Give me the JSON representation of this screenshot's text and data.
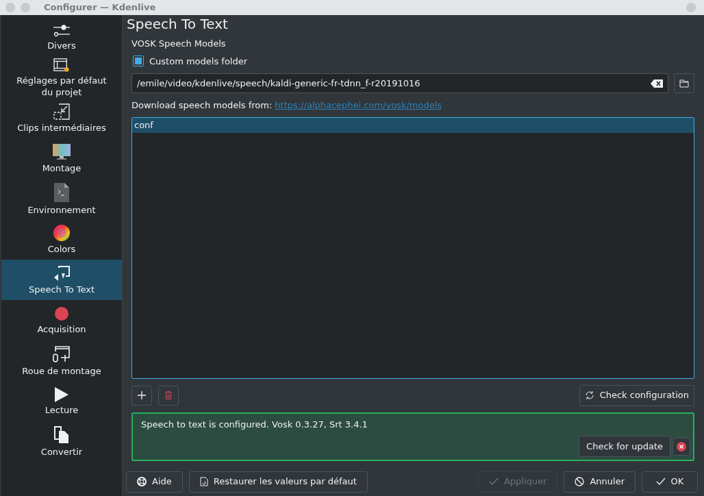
{
  "window": {
    "title": "Configurer — Kdenlive"
  },
  "sidebar": {
    "items": [
      {
        "label": "Divers",
        "selected": false
      },
      {
        "label": "Réglages par défaut du projet",
        "selected": false
      },
      {
        "label": "Clips intermédiaires",
        "selected": false
      },
      {
        "label": "Montage",
        "selected": false
      },
      {
        "label": "Environnement",
        "selected": false
      },
      {
        "label": "Colors",
        "selected": false
      },
      {
        "label": "Speech To Text",
        "selected": true
      },
      {
        "label": "Acquisition",
        "selected": false
      },
      {
        "label": "Roue de montage",
        "selected": false
      },
      {
        "label": "Lecture",
        "selected": false
      },
      {
        "label": "Convertir",
        "selected": false
      }
    ]
  },
  "page": {
    "title": "Speech To Text",
    "section": "VOSK Speech Models",
    "custom_folder": {
      "label": "Custom models folder",
      "checked": true
    },
    "folder_path": {
      "value": "/emile/video/kdenlive/speech/kaldi-generic-fr-tdnn_f-r20191016"
    },
    "download": {
      "text": "Download speech models from:",
      "link": "https://alphacephei.com/vosk/models"
    },
    "models": [
      {
        "name": "conf",
        "selected": true
      }
    ],
    "check_configuration": "Check configuration",
    "status": {
      "message": "Speech to text is configured. Vosk 0.3.27, Srt 3.4.1",
      "button": "Check for update"
    }
  },
  "buttons": [
    {
      "label": "Aide",
      "disabled": false
    },
    {
      "label": "Restaurer les valeurs par défaut",
      "disabled": false
    },
    {
      "label": "Appliquer",
      "disabled": true
    },
    {
      "label": "Annuler",
      "disabled": false
    },
    {
      "label": "OK",
      "disabled": false
    }
  ]
}
